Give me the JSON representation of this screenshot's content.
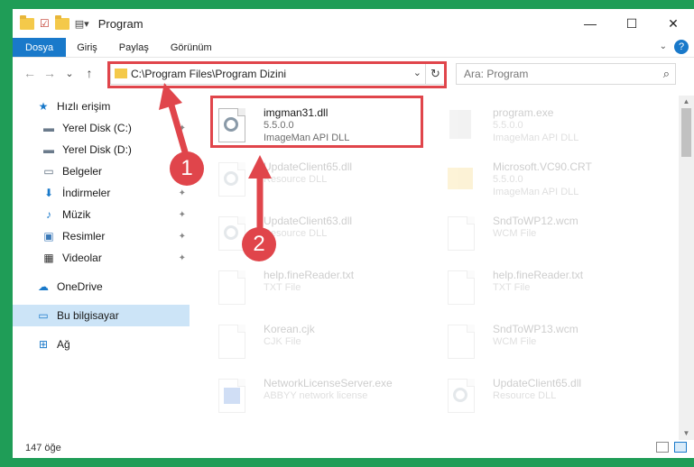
{
  "window": {
    "title": "Program",
    "min": "—",
    "max": "☐",
    "close": "✕"
  },
  "ribbon": {
    "tabs": [
      {
        "label": "Dosya"
      },
      {
        "label": "Giriş"
      },
      {
        "label": "Paylaş"
      },
      {
        "label": "Görünüm"
      }
    ],
    "help": "?"
  },
  "nav": {
    "back": "←",
    "forward": "→",
    "recent": "⌄",
    "up": "↑",
    "address": "C:\\Program Files\\Program Dizini",
    "refresh": "↻",
    "search_placeholder": "Ara: Program",
    "search_icon": "⌕"
  },
  "sidebar": {
    "items": [
      {
        "label": "Hızlı erişim",
        "icon": "star-icon"
      },
      {
        "label": "Yerel Disk (C:)",
        "icon": "drive-icon"
      },
      {
        "label": "Yerel Disk (D:)",
        "icon": "drive-icon"
      },
      {
        "label": "Belgeler",
        "icon": "documents-icon"
      },
      {
        "label": "İndirmeler",
        "icon": "download-icon"
      },
      {
        "label": "Müzik",
        "icon": "music-icon"
      },
      {
        "label": "Resimler",
        "icon": "pictures-icon"
      },
      {
        "label": "Videolar",
        "icon": "videos-icon"
      },
      {
        "label": "OneDrive",
        "icon": "cloud-icon"
      },
      {
        "label": "Bu bilgisayar",
        "icon": "computer-icon"
      },
      {
        "label": "Ağ",
        "icon": "network-icon"
      }
    ]
  },
  "files": [
    {
      "name": "imgman31.dll",
      "version": "5.5.0.0",
      "desc": "ImageMan API DLL"
    },
    {
      "name": "program.exe",
      "version": "5.5.0.0",
      "desc": "ImageMan API DLL"
    },
    {
      "name": "UpdateClient65.dll",
      "version": "",
      "desc": "Resource DLL"
    },
    {
      "name": "Microsoft.VC90.CRT",
      "version": "5.5.0.0",
      "desc": "ImageMan API DLL"
    },
    {
      "name": "UpdateClient63.dll",
      "version": "",
      "desc": "Resource DLL"
    },
    {
      "name": "SndToWP12.wcm",
      "version": "",
      "desc": "WCM File"
    },
    {
      "name": "help.fineReader.txt",
      "version": "",
      "desc": "TXT File"
    },
    {
      "name": "help.fineReader.txt",
      "version": "",
      "desc": "TXT File"
    },
    {
      "name": "Korean.cjk",
      "version": "",
      "desc": "CJK File"
    },
    {
      "name": "SndToWP13.wcm",
      "version": "",
      "desc": "WCM File"
    },
    {
      "name": "NetworkLicenseServer.exe",
      "version": "",
      "desc": "ABBYY network license"
    },
    {
      "name": "UpdateClient65.dll",
      "version": "",
      "desc": "Resource DLL"
    }
  ],
  "status": {
    "count": "147 öğe"
  },
  "annotations": {
    "badge1": "1",
    "badge2": "2"
  },
  "colors": {
    "accent": "#1979ca",
    "highlight": "#e0454b",
    "background": "#1f9d57"
  }
}
